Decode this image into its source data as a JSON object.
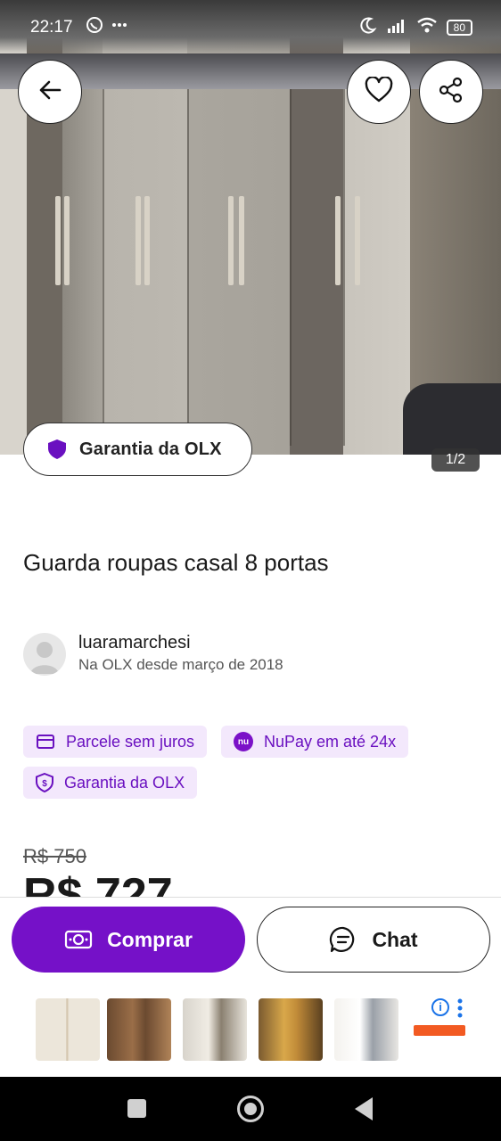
{
  "status_bar": {
    "time": "22:17",
    "left_icons": [
      "whatsapp-icon",
      "more-dots-icon"
    ],
    "right_icons": [
      "moon-icon",
      "signal-icon",
      "wifi-icon"
    ],
    "battery": "80"
  },
  "listing": {
    "photo_counter": "1/2",
    "guarantee_label": "Garantia da OLX",
    "title": "Guarda roupas casal 8 portas",
    "seller": {
      "name": "luaramarchesi",
      "since": "Na OLX desde março de 2018"
    },
    "tags": [
      {
        "label": "Parcele sem juros",
        "icon": "card-icon"
      },
      {
        "label": "NuPay em até 24x",
        "icon": "nu-icon",
        "icon_text": "nu"
      },
      {
        "label": "Garantia da OLX",
        "icon": "shield-dollar-icon"
      }
    ],
    "price_old": "R$ 750",
    "price_new": "R$ 727"
  },
  "actions": {
    "buy_label": "Comprar",
    "chat_label": "Chat"
  },
  "colors": {
    "brand_purple": "#7511c8",
    "tag_bg": "#f3e8fc",
    "tag_text": "#6a10c0"
  }
}
